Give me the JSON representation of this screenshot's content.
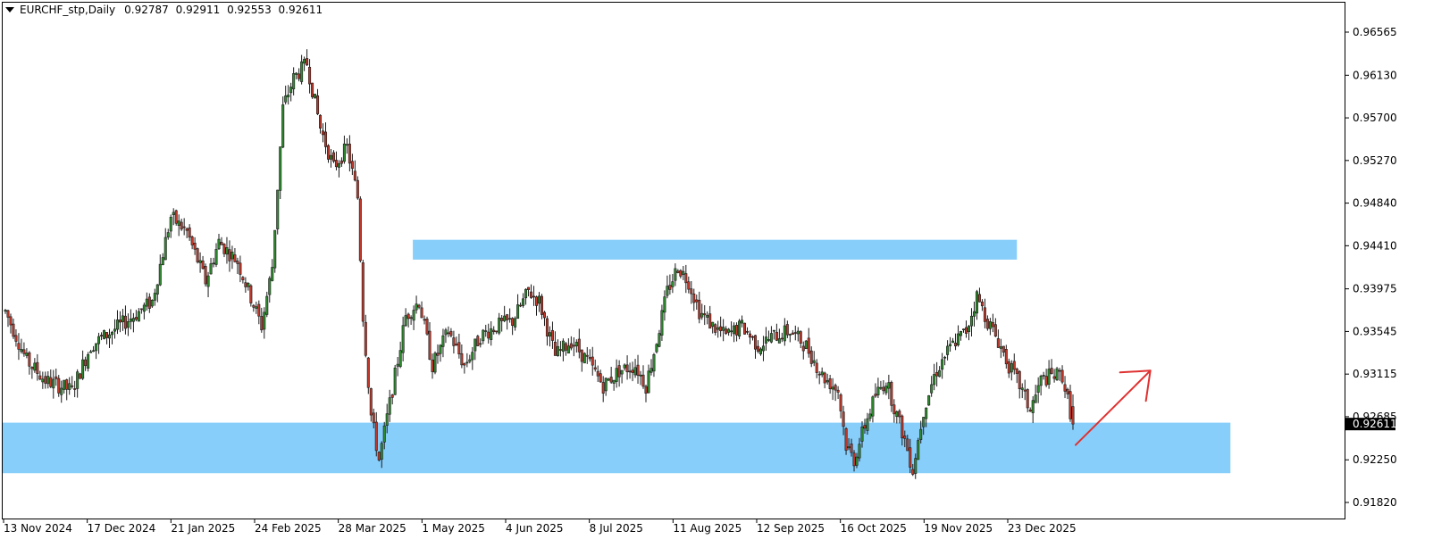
{
  "header": {
    "symbol": "EURCHF_stp,Daily",
    "open": "0.92787",
    "high": "0.92911",
    "low": "0.92553",
    "close": "0.92611"
  },
  "chart_data": {
    "type": "candlestick",
    "title": "EURCHF_stp,Daily",
    "ylim": [
      0.9175,
      0.967
    ],
    "y_ticks": [
      "0.96565",
      "0.96130",
      "0.95700",
      "0.95270",
      "0.94840",
      "0.94410",
      "0.93975",
      "0.93545",
      "0.93115",
      "0.92685",
      "0.92250",
      "0.91820"
    ],
    "current_price": "0.92611",
    "x_ticks": [
      "13 Nov 2024",
      "17 Dec 2024",
      "21 Jan 2025",
      "24 Feb 2025",
      "28 Mar 2025",
      "1 May 2025",
      "4 Jun 2025",
      "8 Jul 2025",
      "11 Aug 2025",
      "12 Sep 2025",
      "16 Oct 2025",
      "19 Nov 2025",
      "23 Dec 2025"
    ],
    "bull_color": "#2e8b2e",
    "bear_color": "#c0392b",
    "zone_color": "#87cefa",
    "arrow_color": "#e03030",
    "zones": [
      {
        "name": "resistance",
        "y_top": 0.9447,
        "y_bottom": 0.9427,
        "bar_start": 154,
        "bar_end": 379
      },
      {
        "name": "support",
        "y_top": 0.92625,
        "y_bottom": 0.92115,
        "bar_start": 0,
        "bar_end": 459
      }
    ],
    "arrow": {
      "from_bar": 401,
      "from_price": 0.924,
      "to_bar": 429,
      "to_price": 0.9315
    },
    "anchors": [
      [
        0,
        0.9375
      ],
      [
        8,
        0.9325
      ],
      [
        15,
        0.9305
      ],
      [
        25,
        0.9295
      ],
      [
        32,
        0.934
      ],
      [
        40,
        0.9355
      ],
      [
        48,
        0.937
      ],
      [
        55,
        0.9385
      ],
      [
        62,
        0.947
      ],
      [
        68,
        0.9455
      ],
      [
        75,
        0.9405
      ],
      [
        80,
        0.9445
      ],
      [
        87,
        0.9425
      ],
      [
        96,
        0.936
      ],
      [
        100,
        0.942
      ],
      [
        104,
        0.958
      ],
      [
        108,
        0.961
      ],
      [
        113,
        0.9625
      ],
      [
        118,
        0.956
      ],
      [
        123,
        0.952
      ],
      [
        128,
        0.954
      ],
      [
        132,
        0.949
      ],
      [
        134,
        0.937
      ],
      [
        137,
        0.927
      ],
      [
        140,
        0.9225
      ],
      [
        146,
        0.931
      ],
      [
        150,
        0.937
      ],
      [
        155,
        0.9385
      ],
      [
        160,
        0.932
      ],
      [
        166,
        0.9355
      ],
      [
        172,
        0.932
      ],
      [
        178,
        0.935
      ],
      [
        184,
        0.936
      ],
      [
        190,
        0.9365
      ],
      [
        196,
        0.9395
      ],
      [
        200,
        0.9385
      ],
      [
        206,
        0.933
      ],
      [
        212,
        0.9345
      ],
      [
        218,
        0.9325
      ],
      [
        224,
        0.93
      ],
      [
        230,
        0.9315
      ],
      [
        236,
        0.932
      ],
      [
        240,
        0.93
      ],
      [
        244,
        0.9345
      ],
      [
        248,
        0.9395
      ],
      [
        252,
        0.942
      ],
      [
        256,
        0.9405
      ],
      [
        260,
        0.9375
      ],
      [
        265,
        0.936
      ],
      [
        270,
        0.935
      ],
      [
        276,
        0.936
      ],
      [
        282,
        0.934
      ],
      [
        288,
        0.935
      ],
      [
        294,
        0.9355
      ],
      [
        300,
        0.934
      ],
      [
        306,
        0.931
      ],
      [
        312,
        0.9295
      ],
      [
        315,
        0.924
      ],
      [
        318,
        0.9225
      ],
      [
        322,
        0.926
      ],
      [
        326,
        0.929
      ],
      [
        330,
        0.9305
      ],
      [
        334,
        0.927
      ],
      [
        337,
        0.9245
      ],
      [
        340,
        0.9215
      ],
      [
        344,
        0.9275
      ],
      [
        348,
        0.931
      ],
      [
        352,
        0.933
      ],
      [
        356,
        0.9345
      ],
      [
        360,
        0.9355
      ],
      [
        364,
        0.939
      ],
      [
        368,
        0.9365
      ],
      [
        372,
        0.9345
      ],
      [
        376,
        0.932
      ],
      [
        380,
        0.93
      ],
      [
        384,
        0.9275
      ],
      [
        388,
        0.9305
      ],
      [
        392,
        0.931
      ],
      [
        396,
        0.931
      ],
      [
        398,
        0.9285
      ],
      [
        400,
        0.9262
      ]
    ]
  }
}
